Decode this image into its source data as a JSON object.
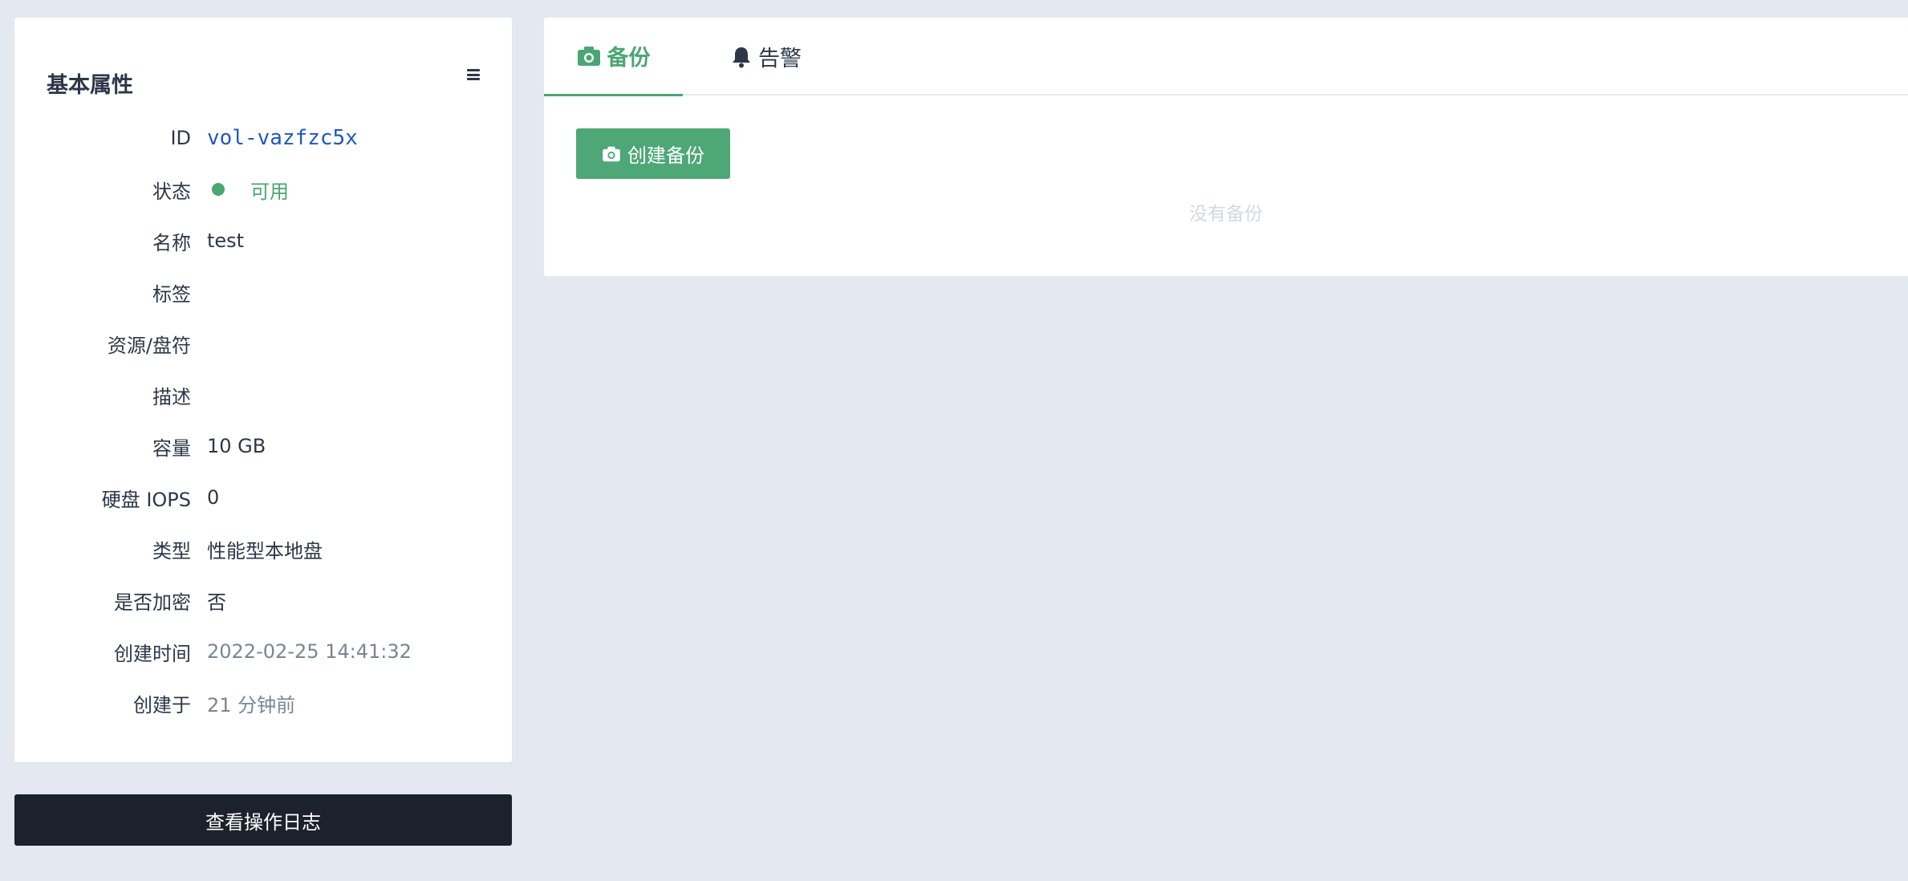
{
  "left_card": {
    "title": "基本属性",
    "menu_icon": "hamburger-icon",
    "properties": [
      {
        "label": "ID",
        "value": "vol-vazfzc5x"
      },
      {
        "label": "状态",
        "value": "可用"
      },
      {
        "label": "名称",
        "value": "test"
      },
      {
        "label": "标签",
        "value": ""
      },
      {
        "label": "资源/盘符",
        "value": ""
      },
      {
        "label": "描述",
        "value": ""
      },
      {
        "label": "容量",
        "value": "10 GB"
      },
      {
        "label": "硬盘 IOPS",
        "value": "0"
      },
      {
        "label": "类型",
        "value": "性能型本地盘"
      },
      {
        "label": "是否加密",
        "value": "否"
      },
      {
        "label": "创建时间",
        "value": "2022-02-25 14:41:32"
      },
      {
        "label": "创建于",
        "value": "21 分钟前"
      }
    ]
  },
  "log_button": {
    "label": "查看操作日志"
  },
  "tabs": [
    {
      "label": "备份",
      "icon": "camera-icon",
      "active": true
    },
    {
      "label": "告警",
      "icon": "bell-icon",
      "active": false
    }
  ],
  "backup": {
    "create_label": "创建备份",
    "empty_text": "没有备份"
  },
  "colors": {
    "accent": "#4aa673",
    "link": "#1f58c4",
    "dark_button": "#1c222c",
    "background": "#e4e9f1"
  }
}
